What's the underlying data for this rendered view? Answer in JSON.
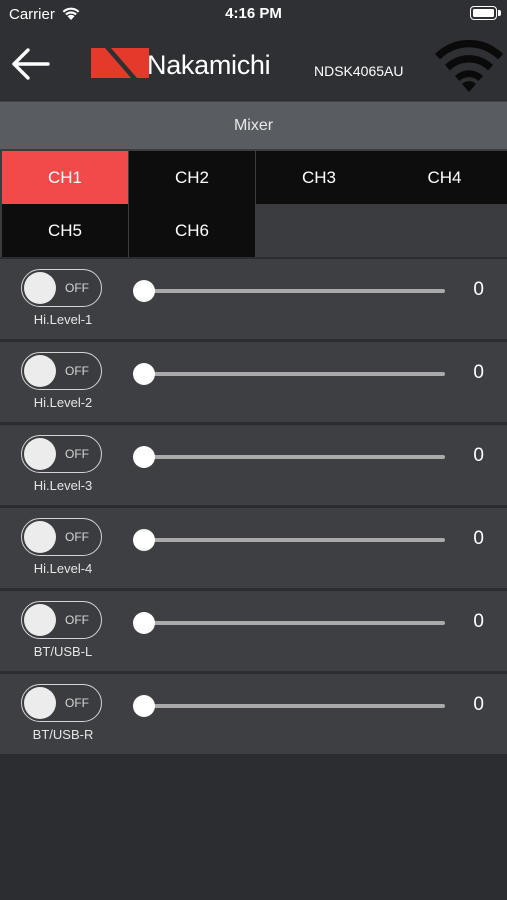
{
  "status": {
    "carrier": "Carrier",
    "time": "4:16 PM"
  },
  "header": {
    "brand": "Nakamichi",
    "device_id": "NDSK4065AU"
  },
  "section": {
    "title": "Mixer"
  },
  "tabs": [
    {
      "label": "CH1",
      "active": true
    },
    {
      "label": "CH2",
      "active": false
    },
    {
      "label": "CH3",
      "active": false
    },
    {
      "label": "CH4",
      "active": false
    },
    {
      "label": "CH5",
      "active": false
    },
    {
      "label": "CH6",
      "active": false
    }
  ],
  "rows": [
    {
      "label": "Hi.Level-1",
      "toggle": "OFF",
      "value": "0"
    },
    {
      "label": "Hi.Level-2",
      "toggle": "OFF",
      "value": "0"
    },
    {
      "label": "Hi.Level-3",
      "toggle": "OFF",
      "value": "0"
    },
    {
      "label": "Hi.Level-4",
      "toggle": "OFF",
      "value": "0"
    },
    {
      "label": "BT/USB-L",
      "toggle": "OFF",
      "value": "0"
    },
    {
      "label": "BT/USB-R",
      "toggle": "OFF",
      "value": "0"
    }
  ],
  "colors": {
    "active_tab": "#f24a4a",
    "brand_red": "#e53a2b"
  }
}
